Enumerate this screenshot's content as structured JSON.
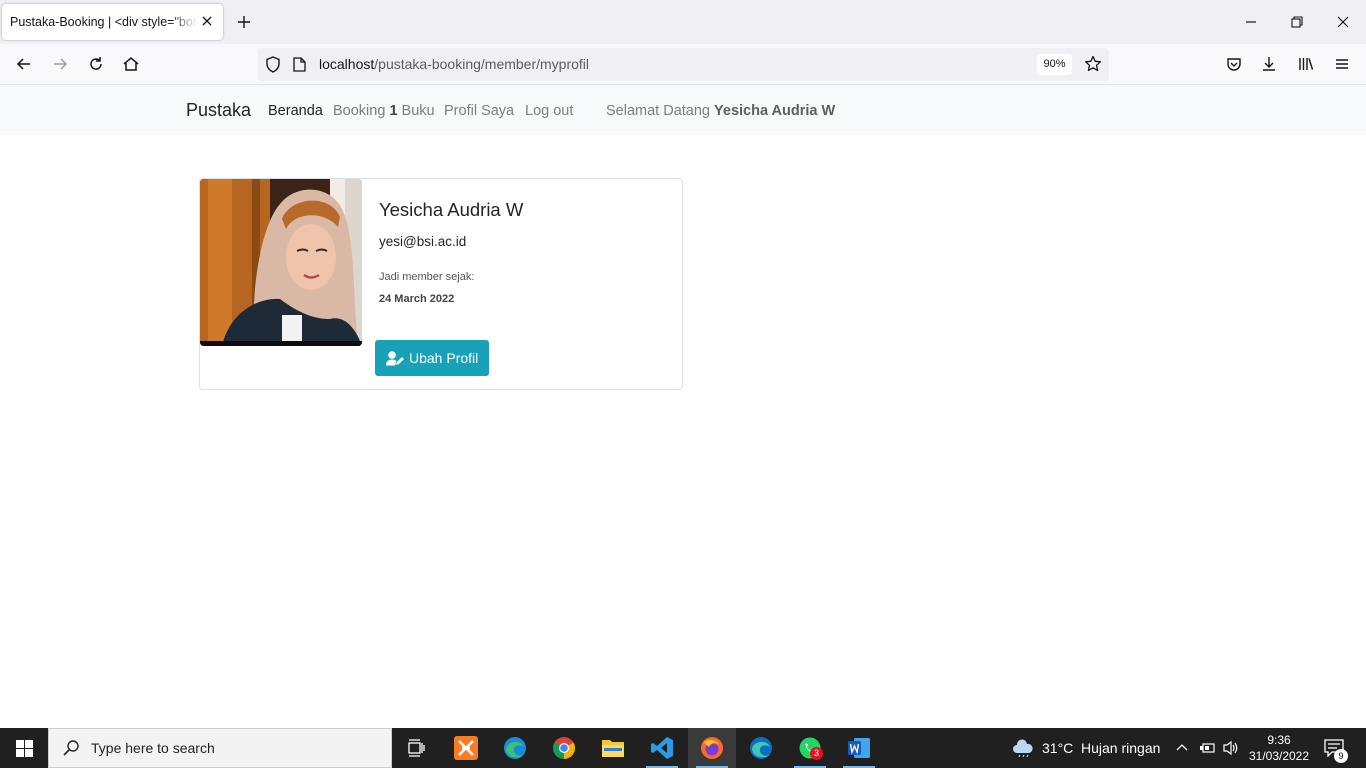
{
  "browser": {
    "tab_title": "Pustaka-Booking | <div style=\"bord",
    "url_host": "localhost",
    "url_path": "/pustaka-booking/member/myprofil",
    "zoom": "90%"
  },
  "site_nav": {
    "brand": "Pustaka",
    "beranda": "Beranda",
    "booking_prefix": "Booking",
    "booking_count": "1",
    "booking_suffix": "Buku",
    "profil": "Profil Saya",
    "logout": "Log out",
    "welcome_prefix": "Selamat Datang",
    "welcome_name": "Yesicha Audria W"
  },
  "profile": {
    "name": "Yesicha Audria W",
    "email": "yesi@bsi.ac.id",
    "since_label": "Jadi member sejak:",
    "since_date": "24 March 2022",
    "edit_button": "Ubah Profil"
  },
  "taskbar": {
    "search_placeholder": "Type here to search",
    "weather_temp": "31°C",
    "weather_desc": "Hujan ringan",
    "time": "9:36",
    "date": "31/03/2022",
    "whatsapp_badge": "3",
    "notification_count": "9"
  },
  "colors": {
    "button_info": "#17a2b8",
    "navbar_bg": "#f8f9fa",
    "taskbar_bg": "#202020"
  }
}
